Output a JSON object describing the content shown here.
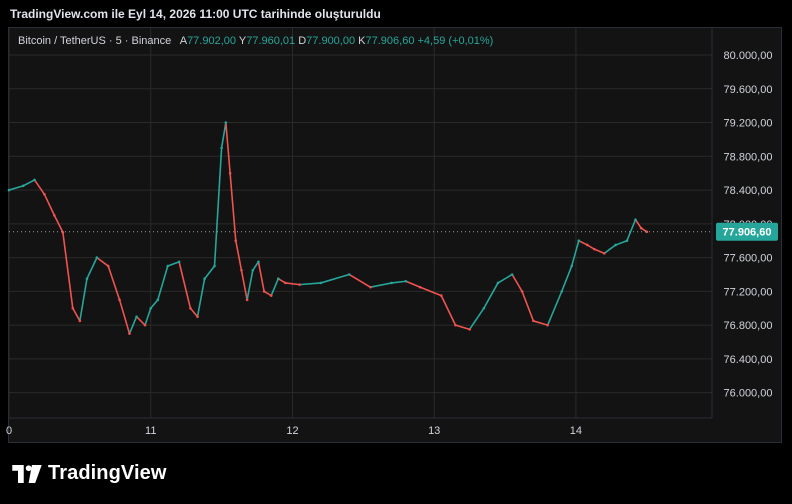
{
  "caption": "TradingView.com ile Eyl 14, 2026 11:00 UTC tarihinde oluşturuldu",
  "legend": {
    "symbol": "Bitcoin / TetherUS · 5 · Binance",
    "open_label": "A",
    "open": "77.902,00",
    "high_label": "Y",
    "high": "77.960,01",
    "low_label": "D",
    "low": "77.900,00",
    "close_label": "K",
    "close": "77.906,60",
    "change": "+4,59 (+0,01%)"
  },
  "brand": {
    "name": "TradingView"
  },
  "colors": {
    "up": "#26a69a",
    "down": "#ef5350",
    "grid": "#2a2a2a",
    "price_tag": "#26a69a"
  },
  "chart_data": {
    "type": "line",
    "title": "",
    "xlabel": "",
    "ylabel": "",
    "x_ticks": [
      "0",
      "11",
      "12",
      "13",
      "14"
    ],
    "y_ticks": [
      "80.000,00",
      "79.600,00",
      "79.200,00",
      "78.800,00",
      "78.400,00",
      "78.000,00",
      "77.600,00",
      "77.200,00",
      "76.800,00",
      "76.400,00",
      "76.000,00"
    ],
    "ylim": [
      75700,
      80320
    ],
    "xlim": [
      0,
      4.96
    ],
    "last_price": 77906.6,
    "last_price_label": "77.906,60",
    "grid": true,
    "series": [
      {
        "x": [
          0,
          0.1,
          0.18,
          0.25,
          0.32,
          0.38,
          0.45,
          0.5,
          0.55,
          0.62,
          0.7,
          0.78,
          0.85,
          0.9,
          0.96,
          1.0,
          1.05,
          1.12,
          1.2,
          1.28,
          1.33,
          1.38,
          1.45,
          1.5,
          1.53,
          1.56,
          1.6,
          1.64,
          1.68,
          1.72,
          1.76,
          1.8,
          1.85,
          1.9,
          1.95,
          2.05,
          2.2,
          2.4,
          2.55,
          2.7,
          2.8,
          2.9,
          3.05,
          3.15,
          3.25,
          3.35,
          3.45,
          3.55,
          3.62,
          3.7,
          3.8,
          3.9,
          3.97,
          4.02,
          4.08,
          4.13,
          4.2,
          4.28,
          4.36,
          4.42,
          4.46,
          4.5
        ],
        "y": [
          78400,
          78450,
          78520,
          78350,
          78100,
          77900,
          77000,
          76850,
          77350,
          77600,
          77500,
          77100,
          76700,
          76900,
          76800,
          77000,
          77100,
          77500,
          77550,
          77000,
          76900,
          77350,
          77500,
          78900,
          79200,
          78600,
          77800,
          77450,
          77100,
          77450,
          77550,
          77200,
          77150,
          77350,
          77300,
          77280,
          77300,
          77400,
          77250,
          77300,
          77320,
          77250,
          77150,
          76800,
          76750,
          77000,
          77300,
          77400,
          77200,
          76850,
          76800,
          77200,
          77500,
          77800,
          77750,
          77700,
          77650,
          77750,
          77800,
          78050,
          77950,
          77906
        ]
      }
    ]
  }
}
